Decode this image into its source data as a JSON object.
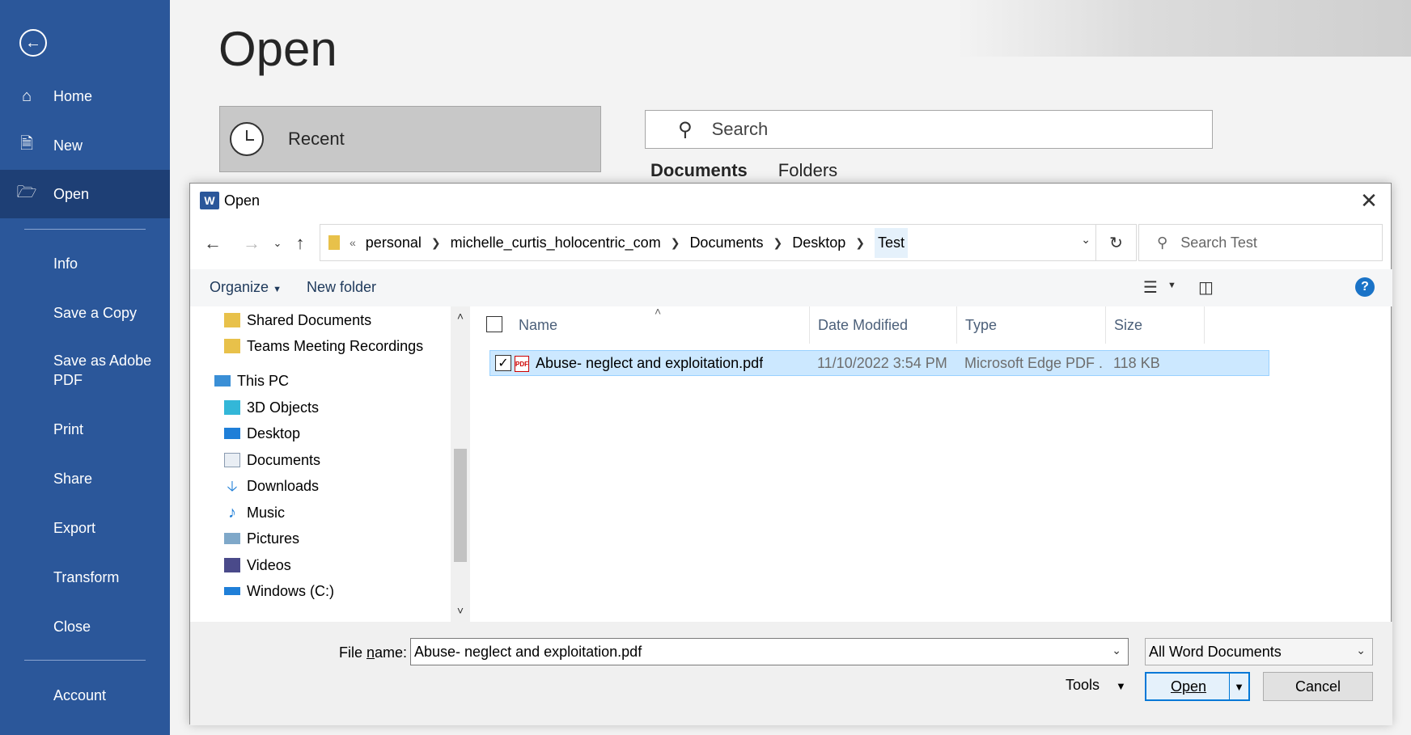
{
  "sidebar": {
    "back_icon": "back-arrow-icon",
    "items": [
      {
        "label": "Home",
        "icon": "home-icon"
      },
      {
        "label": "New",
        "icon": "new-document-icon"
      },
      {
        "label": "Open",
        "icon": "folder-open-icon"
      },
      {
        "label": "Info"
      },
      {
        "label": "Save a Copy"
      },
      {
        "label": "Save as Adobe PDF"
      },
      {
        "label": "Print"
      },
      {
        "label": "Share"
      },
      {
        "label": "Export"
      },
      {
        "label": "Transform"
      },
      {
        "label": "Close"
      },
      {
        "label": "Account"
      }
    ]
  },
  "backstage": {
    "title": "Open",
    "recent_label": "Recent",
    "search_placeholder": "Search",
    "tabs": [
      "Documents",
      "Folders"
    ]
  },
  "dialog": {
    "title": "Open",
    "close_icon": "close-icon",
    "breadcrumb": [
      "personal",
      "michelle_curtis_holocentric_com",
      "Documents",
      "Desktop",
      "Test"
    ],
    "breadcrumb_overflow": "«",
    "search_placeholder": "Search Test",
    "organize_label": "Organize",
    "new_folder_label": "New folder",
    "nav_tree": [
      {
        "label": "Shared Documents",
        "icon": "folder-shared-icon"
      },
      {
        "label": "Teams Meeting Recordings",
        "icon": "folder-icon"
      },
      {
        "label": "This PC",
        "icon": "computer-icon"
      },
      {
        "label": "3D Objects",
        "icon": "3d-objects-icon"
      },
      {
        "label": "Desktop",
        "icon": "desktop-icon"
      },
      {
        "label": "Documents",
        "icon": "documents-icon"
      },
      {
        "label": "Downloads",
        "icon": "downloads-icon"
      },
      {
        "label": "Music",
        "icon": "music-icon"
      },
      {
        "label": "Pictures",
        "icon": "pictures-icon"
      },
      {
        "label": "Videos",
        "icon": "videos-icon"
      },
      {
        "label": "Windows (C:)",
        "icon": "drive-icon"
      }
    ],
    "columns": [
      "Name",
      "Date Modified",
      "Type",
      "Size"
    ],
    "files": [
      {
        "name": "Abuse- neglect and exploitation.pdf",
        "date": "11/10/2022 3:54 PM",
        "type": "Microsoft Edge PDF ...",
        "size": "118 KB",
        "selected": true
      }
    ],
    "file_name_label": "File name:",
    "file_name_value": "Abuse- neglect and exploitation.pdf",
    "filter_value": "All Word Documents",
    "tools_label": "Tools",
    "open_label": "Open",
    "cancel_label": "Cancel"
  },
  "colors": {
    "sidebar_bg": "#2b579a",
    "sidebar_active": "#1e3f75",
    "selection_bg": "#cce8ff",
    "accent": "#0078d7"
  }
}
